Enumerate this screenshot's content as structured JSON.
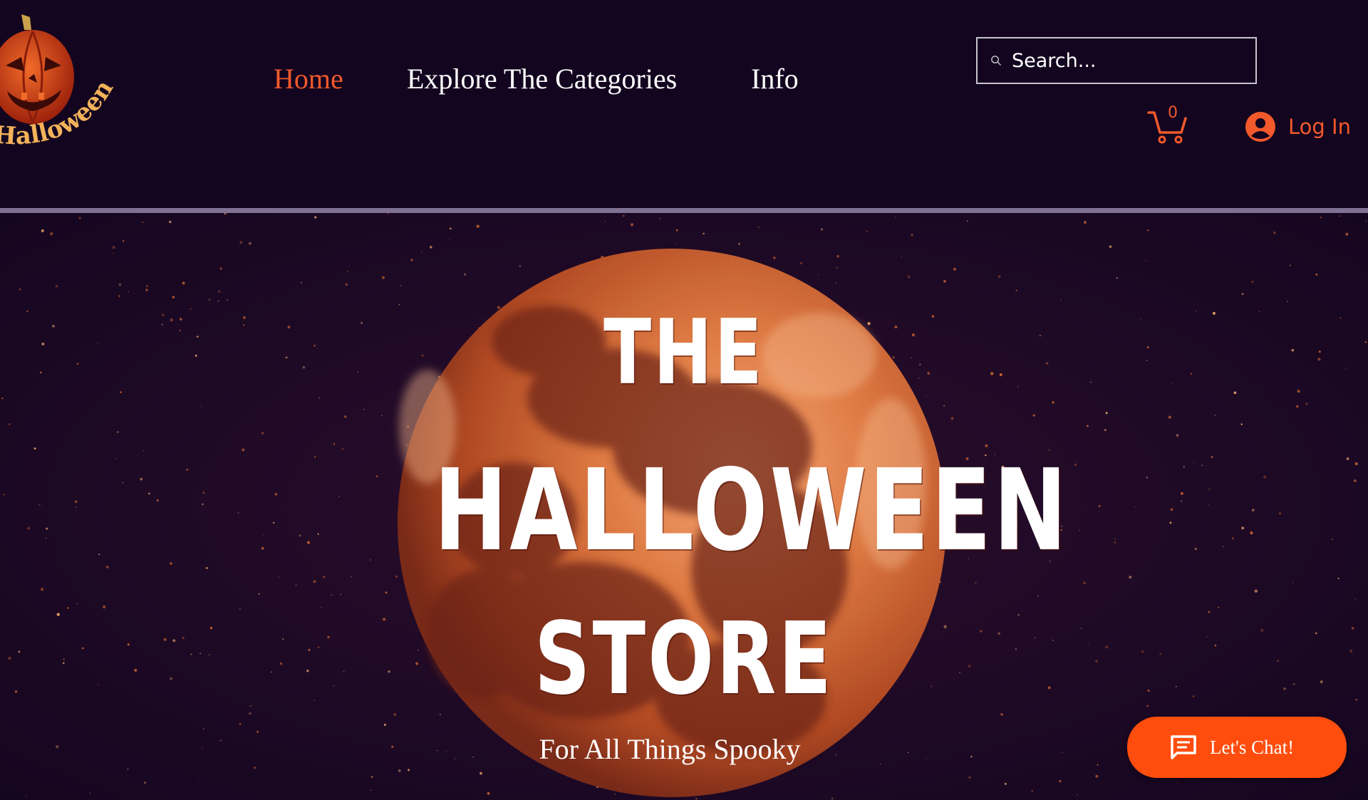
{
  "colors": {
    "background": "#13051f",
    "accent": "#f2592b",
    "chat_button": "#ff4d0d",
    "divider": "#7f7194",
    "moon": "#d0652e"
  },
  "logo": {
    "text": "Halloween Store",
    "icon": "pumpkin-logo-icon"
  },
  "nav": {
    "items": [
      {
        "label": "Home",
        "active": true
      },
      {
        "label": "Explore The Categories",
        "active": false
      },
      {
        "label": "Info",
        "active": false
      }
    ]
  },
  "search": {
    "placeholder": "Search...",
    "value": "",
    "icon": "search-icon"
  },
  "cart": {
    "count": "0",
    "icon": "cart-icon"
  },
  "login": {
    "label": "Log In",
    "icon": "user-avatar-icon"
  },
  "hero": {
    "title_line1": "THE",
    "title_line2": "HALLOWEEN",
    "title_line3": "STORE",
    "tagline": "For All Things Spooky"
  },
  "chat": {
    "label": "Let's Chat!",
    "icon": "chat-bubble-icon"
  }
}
